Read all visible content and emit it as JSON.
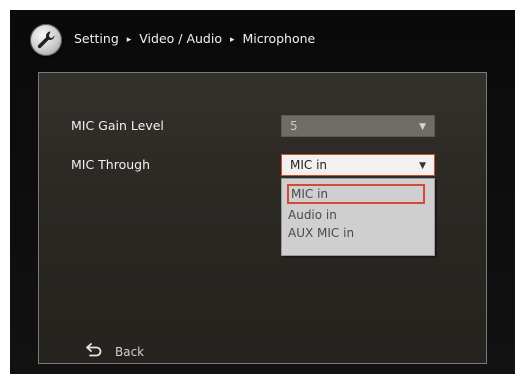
{
  "header": {
    "icon": "wrench-icon",
    "crumbs": [
      "Setting",
      "Video / Audio",
      "Microphone"
    ],
    "separator": "▸"
  },
  "settings": {
    "gain": {
      "label": "MIC Gain Level",
      "value": "5"
    },
    "through": {
      "label": "MIC Through",
      "value": "MIC in",
      "options": [
        "MIC in",
        "Audio in",
        "AUX MIC in"
      ],
      "selected_index": 0
    }
  },
  "footer": {
    "back_label": "Back",
    "back_icon": "back-arrow-icon"
  },
  "colors": {
    "background": "#0e0e0e",
    "panel": "#2b2824",
    "panel_border": "#7a7a7a",
    "focus_border": "#d44a3a",
    "dropdown_bg": "#cfcfcf"
  }
}
